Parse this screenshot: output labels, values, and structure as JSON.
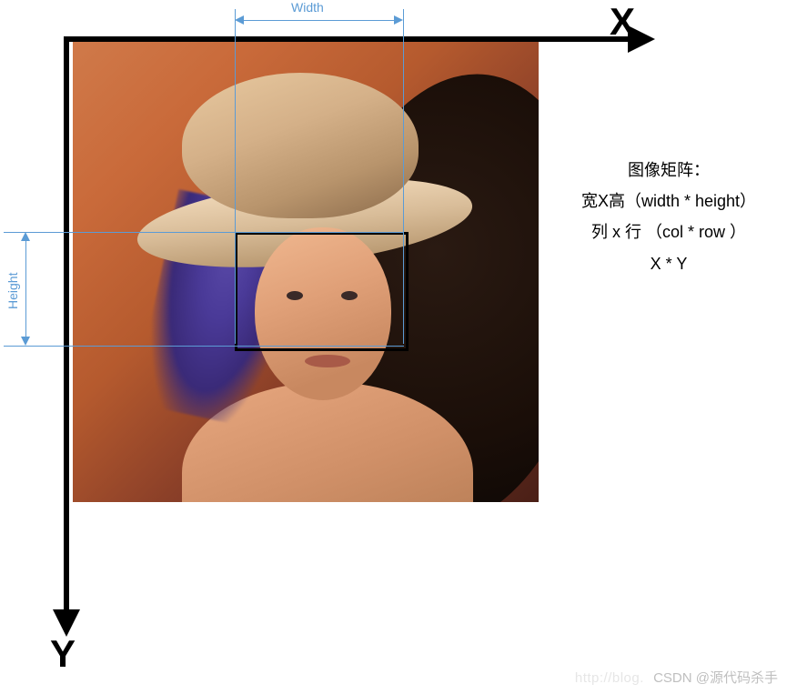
{
  "axes": {
    "x_label": "X",
    "y_label": "Y"
  },
  "dimensions": {
    "width_label": "Width",
    "height_label": "Height"
  },
  "info": {
    "title": "图像矩阵：",
    "line1": "宽X高（width * height）",
    "line2": "列 x 行 （col * row ）",
    "line3": "X * Y"
  },
  "watermark": {
    "faint": "http://blog.",
    "text": "CSDN @源代码杀手"
  }
}
